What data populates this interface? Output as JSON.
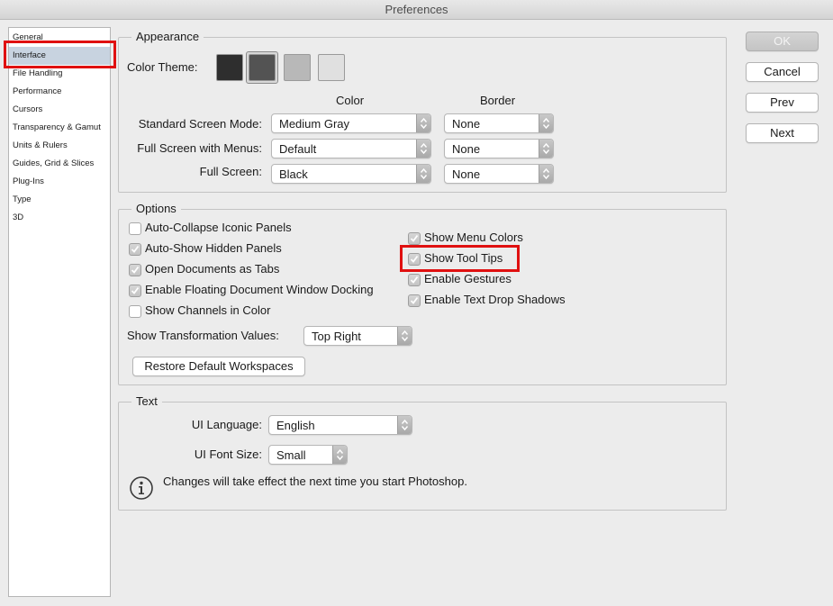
{
  "window": {
    "title": "Preferences"
  },
  "sidebar": {
    "items": [
      {
        "label": "General"
      },
      {
        "label": "Interface"
      },
      {
        "label": "File Handling"
      },
      {
        "label": "Performance"
      },
      {
        "label": "Cursors"
      },
      {
        "label": "Transparency & Gamut"
      },
      {
        "label": "Units & Rulers"
      },
      {
        "label": "Guides, Grid & Slices"
      },
      {
        "label": "Plug-Ins"
      },
      {
        "label": "Type"
      },
      {
        "label": "3D"
      }
    ],
    "selected": "Interface"
  },
  "appearance": {
    "title": "Appearance",
    "color_theme_label": "Color Theme:",
    "themes": [
      "#2e2e2e",
      "#535353",
      "#b8b8b8",
      "#e0e0e0"
    ],
    "selected_theme_index": 1,
    "col_color": "Color",
    "col_border": "Border",
    "rows": [
      {
        "label": "Standard Screen Mode:",
        "color": "Medium Gray",
        "border": "None"
      },
      {
        "label": "Full Screen with Menus:",
        "color": "Default",
        "border": "None"
      },
      {
        "label": "Full Screen:",
        "color": "Black",
        "border": "None"
      }
    ]
  },
  "options": {
    "title": "Options",
    "left": [
      {
        "label": "Auto-Collapse Iconic Panels",
        "checked": false
      },
      {
        "label": "Auto-Show Hidden Panels",
        "checked": true
      },
      {
        "label": "Open Documents as Tabs",
        "checked": true
      },
      {
        "label": "Enable Floating Document Window Docking",
        "checked": true
      },
      {
        "label": "Show Channels in Color",
        "checked": false
      }
    ],
    "right": [
      {
        "label": "Show Menu Colors",
        "checked": true
      },
      {
        "label": "Show Tool Tips",
        "checked": true
      },
      {
        "label": "Enable Gestures",
        "checked": true
      },
      {
        "label": "Enable Text Drop Shadows",
        "checked": true
      }
    ],
    "transform_label": "Show Transformation Values:",
    "transform_value": "Top Right",
    "restore_button": "Restore Default Workspaces"
  },
  "text": {
    "title": "Text",
    "ui_language_label": "UI Language:",
    "ui_language_value": "English",
    "ui_font_size_label": "UI Font Size:",
    "ui_font_size_value": "Small",
    "note": "Changes will take effect the next time you start Photoshop."
  },
  "buttons": {
    "ok": "OK",
    "cancel": "Cancel",
    "prev": "Prev",
    "next": "Next"
  },
  "highlight_color": "#e01010"
}
